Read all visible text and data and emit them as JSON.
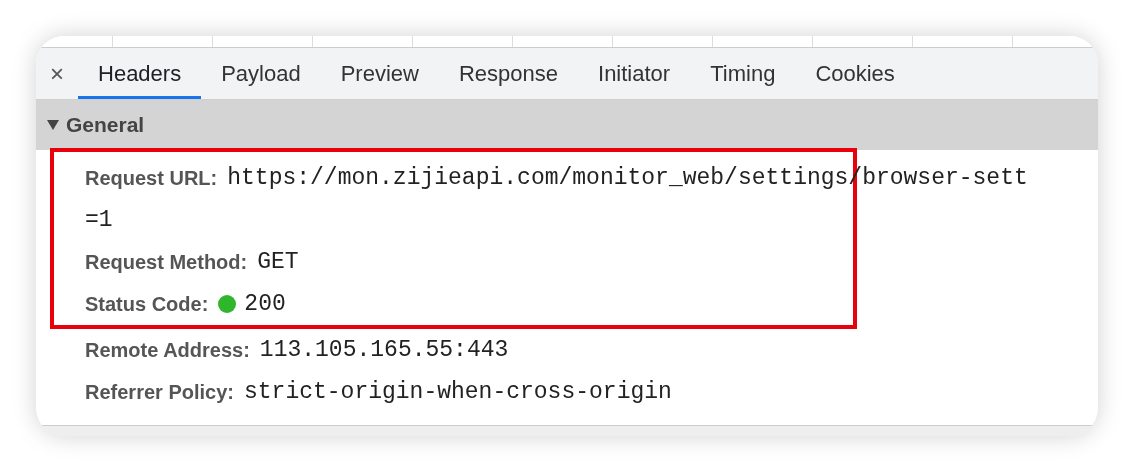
{
  "close_button": "×",
  "tabs": [
    {
      "label": "Headers",
      "selected": true
    },
    {
      "label": "Payload",
      "selected": false
    },
    {
      "label": "Preview",
      "selected": false
    },
    {
      "label": "Response",
      "selected": false
    },
    {
      "label": "Initiator",
      "selected": false
    },
    {
      "label": "Timing",
      "selected": false
    },
    {
      "label": "Cookies",
      "selected": false
    }
  ],
  "section": {
    "title": "General",
    "expanded": true
  },
  "rows": [
    {
      "label": "Request URL:",
      "value": "https://mon.zijieapi.com/monitor_web/settings/browser-sett",
      "value_continued": "=1",
      "highlighted": true
    },
    {
      "label": "Request Method:",
      "value": "GET",
      "highlighted": true
    },
    {
      "label": "Status Code:",
      "value": "200",
      "color": "#2fb62a",
      "highlighted": true
    },
    {
      "label": "Remote Address:",
      "value": "113.105.165.55:443",
      "highlighted": false
    },
    {
      "label": "Referrer Policy:",
      "value": "strict-origin-when-cross-origin",
      "highlighted": false
    }
  ]
}
